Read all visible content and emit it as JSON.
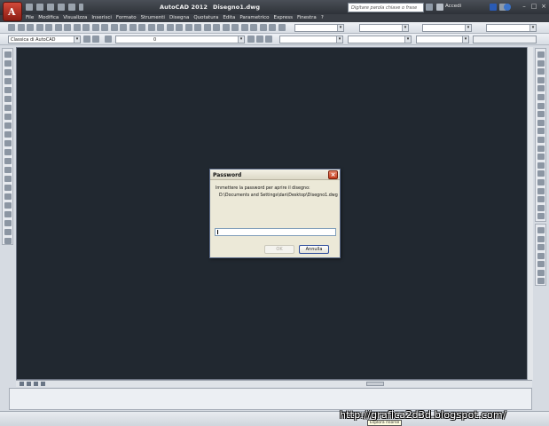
{
  "titlebar": {
    "app_name": "AutoCAD 2012",
    "document": "Disegno1.dwg",
    "search_placeholder": "Digitare parola chiave o frase",
    "signin_label": "Accedi"
  },
  "menubar": {
    "items": [
      "File",
      "Modifica",
      "Visualizza",
      "Inserisci",
      "Formato",
      "Strumenti",
      "Disegna",
      "Quotatura",
      "Edita",
      "Parametrico",
      "Express",
      "Finestra",
      "?"
    ]
  },
  "toolbar2": {
    "workspace": "Classica di AutoCAD",
    "layer": "0"
  },
  "dialog": {
    "title": "Password",
    "message": "Immettere la password per aprire il disegno:",
    "path": "D:\\Documents and Settings\\dan\\Desktop\\Disegno1.dwg",
    "password_value": "",
    "ok_label": "OK",
    "cancel_label": "Annulla"
  },
  "status": {
    "tooltip": "Esplora risorse",
    "watermark": "http://grafica2d3d.blogspot.com/"
  },
  "colors": {
    "canvas": "#212830",
    "titlebar": "#2c3036",
    "app_button": "#b0281a"
  }
}
